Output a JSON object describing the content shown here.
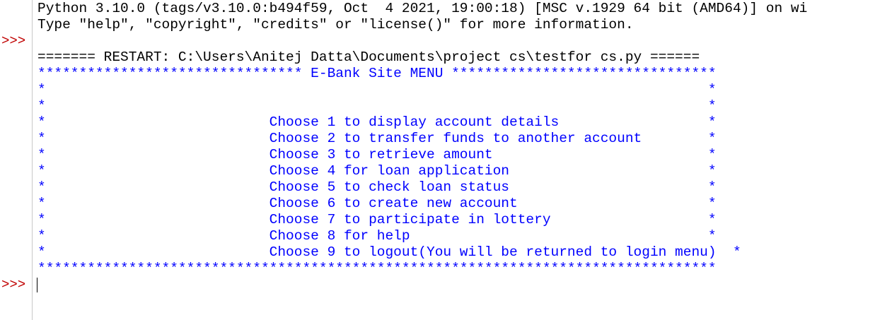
{
  "shell": {
    "prompt": ">>>",
    "banner_line_1": "Python 3.10.0 (tags/v3.10.0:b494f59, Oct  4 2021, 19:00:18) [MSC v.1929 64 bit (AMD64)] on wi",
    "banner_line_2": "Type \"help\", \"copyright\", \"credits\" or \"license()\" for more information.",
    "restart_line": "======= RESTART: C:\\Users\\Anitej Datta\\Documents\\project cs\\testfor cs.py ======"
  },
  "menu": {
    "top_border": "******************************** E-Bank Site MENU ********************************",
    "lines": [
      "*                                                                                *",
      "*                                                                                *",
      "*                           Choose 1 to display account details                  *",
      "*                           Choose 2 to transfer funds to another account        *",
      "*                           Choose 3 to retrieve amount                          *",
      "*                           Choose 4 for loan application                        *",
      "*                           Choose 5 to check loan status                        *",
      "*                           Choose 6 to create new account                       *",
      "*                           Choose 7 to participate in lottery                   *",
      "*                           Choose 8 for help                                    *",
      "*                           Choose 9 to logout(You will be returned to login menu)  *"
    ],
    "bottom_border": "**********************************************************************************"
  },
  "colors": {
    "stdout": "#0000ff",
    "prompt": "#c00000",
    "text": "#000000"
  }
}
